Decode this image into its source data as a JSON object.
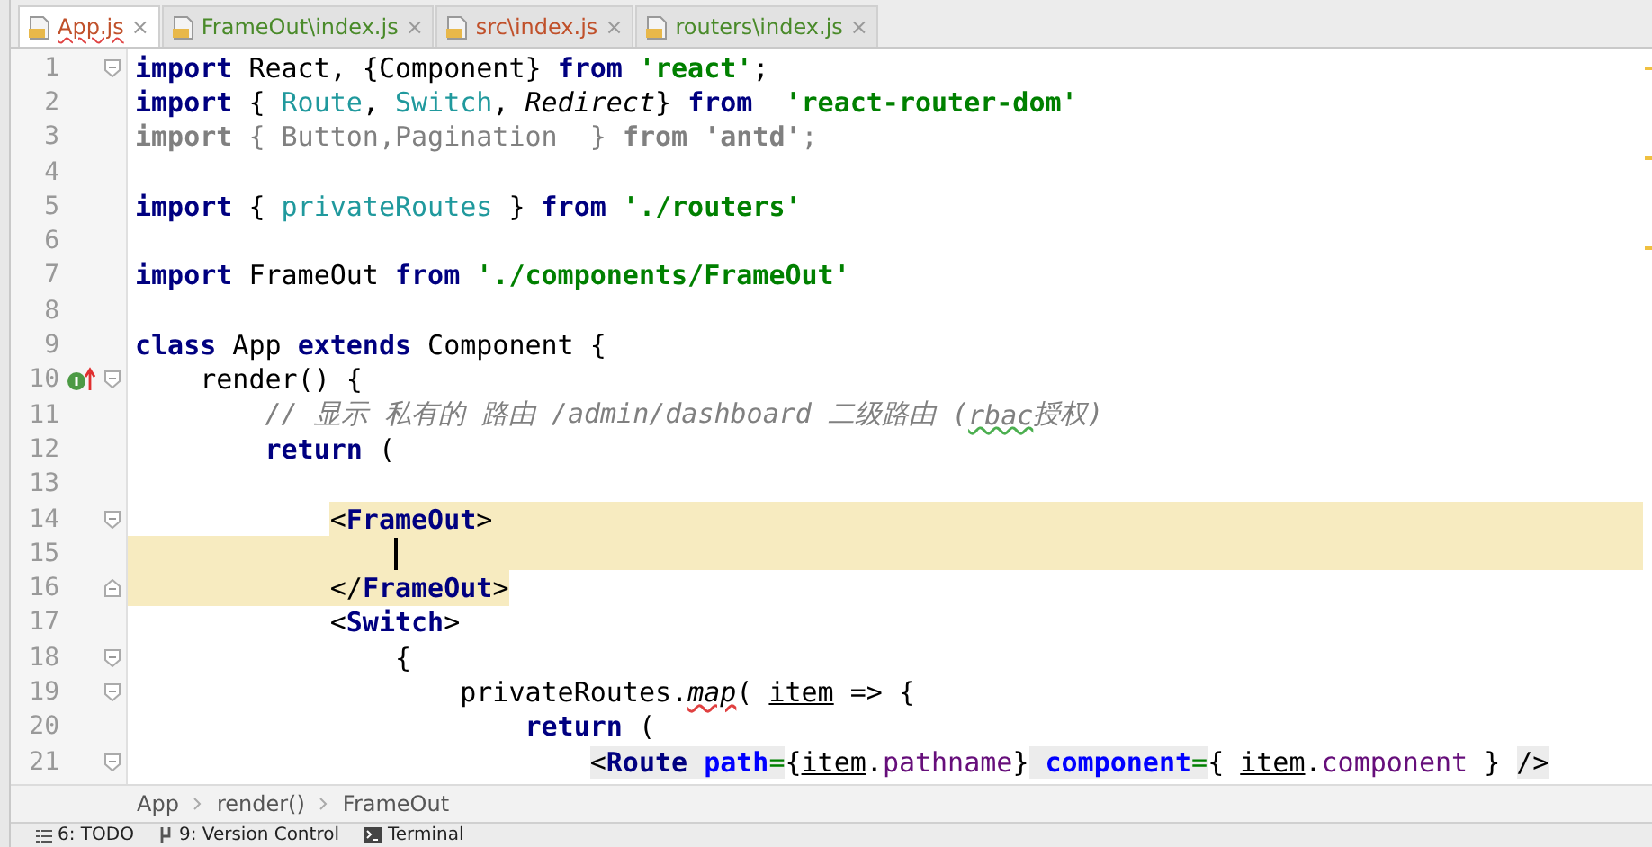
{
  "tabs": [
    {
      "label": "App.js",
      "selected": true,
      "color": "#c0502a",
      "close": "×"
    },
    {
      "label": "FrameOut\\index.js",
      "selected": false,
      "color": "#4a8a2a",
      "close": "×"
    },
    {
      "label": "src\\index.js",
      "selected": false,
      "color": "#c0502a",
      "close": "×"
    },
    {
      "label": "routers\\index.js",
      "selected": false,
      "color": "#4a8a2a",
      "close": "×"
    }
  ],
  "editor": {
    "lines": [
      {
        "number": "1",
        "fold_start": true,
        "tokens": [
          {
            "text": "import",
            "kind": "keyword"
          },
          {
            "text": " React, {Component} ",
            "kind": "plain"
          },
          {
            "text": "from ",
            "kind": "keyword"
          },
          {
            "text": "'react'",
            "kind": "string"
          },
          {
            "text": ";",
            "kind": "plain"
          }
        ]
      },
      {
        "number": "2",
        "tokens": [
          {
            "text": "import",
            "kind": "keyword"
          },
          {
            "text": " { ",
            "kind": "plain"
          },
          {
            "text": "Route",
            "kind": "type"
          },
          {
            "text": ", ",
            "kind": "plain"
          },
          {
            "text": "Switch",
            "kind": "type"
          },
          {
            "text": ", ",
            "kind": "plain"
          },
          {
            "text": "Redirect",
            "kind": "italic"
          },
          {
            "text": "} ",
            "kind": "plain"
          },
          {
            "text": "from  ",
            "kind": "keyword"
          },
          {
            "text": "'react-router-dom'",
            "kind": "string"
          }
        ]
      },
      {
        "number": "3",
        "tokens": [
          {
            "text": "import",
            "kind": "faded-bold"
          },
          {
            "text": " { Button,Pagination  } ",
            "kind": "faded"
          },
          {
            "text": "from ",
            "kind": "faded-bold"
          },
          {
            "text": "'antd'",
            "kind": "faded-bold"
          },
          {
            "text": ";",
            "kind": "faded"
          }
        ]
      },
      {
        "number": "4"
      },
      {
        "number": "5",
        "tokens": [
          {
            "text": "import",
            "kind": "keyword"
          },
          {
            "text": " { ",
            "kind": "plain"
          },
          {
            "text": "privateRoutes",
            "kind": "type"
          },
          {
            "text": " } ",
            "kind": "plain"
          },
          {
            "text": "from ",
            "kind": "keyword"
          },
          {
            "text": "'./routers'",
            "kind": "string"
          }
        ]
      },
      {
        "number": "6"
      },
      {
        "number": "7",
        "tokens": [
          {
            "text": "import",
            "kind": "keyword"
          },
          {
            "text": " FrameOut ",
            "kind": "plain"
          },
          {
            "text": "from ",
            "kind": "keyword"
          },
          {
            "text": "'./components/FrameOut'",
            "kind": "string"
          }
        ]
      },
      {
        "number": "8"
      },
      {
        "number": "9",
        "tokens": [
          {
            "text": "class",
            "kind": "keyword"
          },
          {
            "text": " App ",
            "kind": "plain"
          },
          {
            "text": "extends",
            "kind": "keyword"
          },
          {
            "text": " Component {",
            "kind": "plain"
          }
        ]
      },
      {
        "number": "10",
        "fold_start": true,
        "override_marker": true,
        "tokens": [
          {
            "text": "    render",
            "kind": "plain"
          },
          {
            "text": "() {",
            "kind": "plain"
          }
        ]
      },
      {
        "number": "11",
        "tokens": [
          {
            "text": "        // 显示 私有的 路由 /admin/dashboard 二级路由 (",
            "kind": "comment"
          },
          {
            "text": "rbac",
            "kind": "comment",
            "typo": true
          },
          {
            "text": "授权)",
            "kind": "comment"
          }
        ]
      },
      {
        "number": "12",
        "tokens": [
          {
            "text": "        return",
            "kind": "keyword"
          },
          {
            "text": " (",
            "kind": "plain"
          }
        ]
      },
      {
        "number": "13"
      },
      {
        "number": "14",
        "fold_start": true,
        "highlight_start": true,
        "tokens": [
          {
            "text": "            <",
            "kind": "plain"
          },
          {
            "text": "FrameOut",
            "kind": "tag"
          },
          {
            "text": ">",
            "kind": "plain"
          }
        ]
      },
      {
        "number": "15",
        "highlighted": true,
        "caret": true
      },
      {
        "number": "16",
        "fold_end": true,
        "highlight_end": true,
        "tokens": [
          {
            "text": "            </",
            "kind": "plain"
          },
          {
            "text": "FrameOut",
            "kind": "tag"
          },
          {
            "text": ">",
            "kind": "plain"
          }
        ]
      },
      {
        "number": "17",
        "tokens": [
          {
            "text": "            <",
            "kind": "plain"
          },
          {
            "text": "Switch",
            "kind": "tag"
          },
          {
            "text": ">",
            "kind": "plain"
          }
        ]
      },
      {
        "number": "18",
        "fold_start": true,
        "tokens": [
          {
            "text": "                {",
            "kind": "plain"
          }
        ]
      },
      {
        "number": "19",
        "fold_start": true,
        "tokens": [
          {
            "text": "                    privateRoutes.",
            "kind": "plain"
          },
          {
            "text": "map",
            "kind": "italic",
            "error": true
          },
          {
            "text": "( ",
            "kind": "plain"
          },
          {
            "text": "item",
            "kind": "plain",
            "underlined": true
          },
          {
            "text": " => {",
            "kind": "plain"
          }
        ]
      },
      {
        "number": "20",
        "tokens": [
          {
            "text": "                        return",
            "kind": "keyword"
          },
          {
            "text": " (",
            "kind": "plain"
          }
        ]
      },
      {
        "number": "21",
        "fold_start": true,
        "tokens": [
          {
            "text": "                            <",
            "kind": "plain",
            "shaded": true
          },
          {
            "text": "Route ",
            "kind": "tag",
            "shaded": true
          },
          {
            "text": "path",
            "kind": "attr",
            "shaded": true
          },
          {
            "text": "=",
            "kind": "eq",
            "shaded": true
          },
          {
            "text": "{",
            "kind": "plain"
          },
          {
            "text": "item",
            "kind": "plain",
            "underlined": true
          },
          {
            "text": ".",
            "kind": "plain"
          },
          {
            "text": "pathname",
            "kind": "prop"
          },
          {
            "text": "}",
            "kind": "plain"
          },
          {
            "text": " component",
            "kind": "attr",
            "shaded": true
          },
          {
            "text": "=",
            "kind": "eq",
            "shaded": true
          },
          {
            "text": "{ ",
            "kind": "plain"
          },
          {
            "text": "item",
            "kind": "plain",
            "underlined": true
          },
          {
            "text": ".",
            "kind": "plain"
          },
          {
            "text": "component",
            "kind": "prop"
          },
          {
            "text": " } ",
            "kind": "plain"
          },
          {
            "text": "/>",
            "kind": "plain",
            "shaded": true
          }
        ]
      }
    ]
  },
  "breadcrumb": [
    "App",
    "render()",
    "FrameOut"
  ],
  "tool_windows": [
    {
      "label": "6: TODO",
      "kind": "todo"
    },
    {
      "label": "9: Version Control",
      "kind": "vcs"
    },
    {
      "label": "Terminal",
      "kind": "terminal"
    }
  ]
}
